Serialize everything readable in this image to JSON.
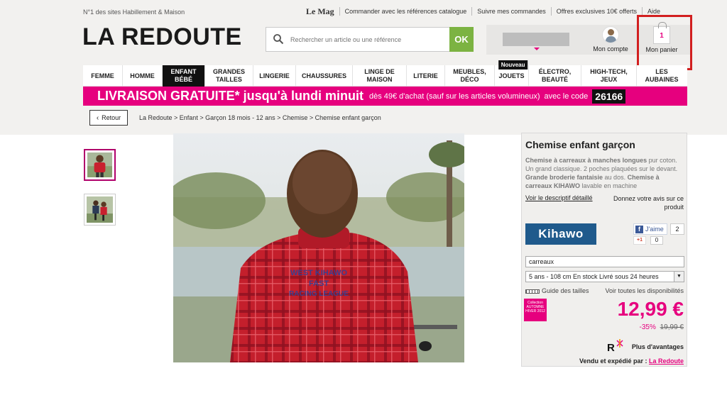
{
  "header": {
    "tagline": "N°1 des sites Habillement & Maison",
    "top_links": [
      "Le Mag",
      "Commander avec les références catalogue",
      "Suivre mes commandes",
      "Offres exclusives 10€ offerts",
      "Aide"
    ],
    "logo": "LA REDOUTE",
    "search": {
      "placeholder": "Rechercher un article ou une référence",
      "button": "OK"
    },
    "account_label": "Mon compte",
    "cart_label": "Mon panier",
    "cart_count": "1"
  },
  "nav": {
    "items": [
      {
        "label_lines": [
          "FEMME"
        ]
      },
      {
        "label_lines": [
          "HOMME"
        ]
      },
      {
        "label_lines": [
          "ENFANT",
          "BÉBÉ"
        ],
        "active": true
      },
      {
        "label_lines": [
          "GRANDES",
          "TAILLES"
        ]
      },
      {
        "label_lines": [
          "LINGERIE"
        ]
      },
      {
        "label_lines": [
          "CHAUSSURES"
        ]
      },
      {
        "label_lines": [
          "LINGE DE",
          "MAISON"
        ]
      },
      {
        "label_lines": [
          "LITERIE"
        ]
      },
      {
        "label_lines": [
          "MEUBLES,",
          "DÉCO"
        ]
      },
      {
        "label_lines": [
          "JOUETS"
        ],
        "badge": "Nouveau"
      },
      {
        "label_lines": [
          "ÉLECTRO,",
          "BEAUTÉ"
        ]
      },
      {
        "label_lines": [
          "HIGH-TECH,",
          "JEUX"
        ]
      },
      {
        "label_lines": [
          "LES",
          "AUBAINES"
        ]
      }
    ]
  },
  "promo": {
    "headline": "LIVRAISON GRATUITE* jusqu'à lundi minuit",
    "condition": "dès 49€ d'achat (sauf sur les articles volumineux)",
    "with_code": "avec le code",
    "code": "26166"
  },
  "back_label": "Retour",
  "breadcrumb": "La Redoute > Enfant > Garçon 18 mois - 12 ans > Chemise > Chemise enfant garçon",
  "product": {
    "title": "Chemise enfant garçon",
    "desc_bold1": "Chemise à carreaux à manches longues",
    "desc1": " pur coton. Un grand classique. 2 poches plaquées sur le devant. ",
    "desc_bold2": "Grande broderie fantaisie",
    "desc2": " au dos. ",
    "desc_bold3": "Chemise à carreaux KIHAWO",
    "desc3": " lavable en machine",
    "link_description": "Voir le descriptif détaillé",
    "link_review": "Donnez votre avis sur ce produit",
    "brand": "Kihawo",
    "like_label": "J'aime",
    "like_count": "2",
    "gplus_label": "+1",
    "gplus_count": "0",
    "color_value": "carreaux",
    "size_value": "5 ans - 108 cm En stock Livré sous 24 heures",
    "size_guide": "Guide des tailles",
    "availability": "Voir toutes les disponibilités",
    "collection_badge": "Collection AUTOMNE HIVER 2012",
    "price": "12,99 €",
    "discount": "-35%",
    "old_price": "19,99 €",
    "plus_label": "Plus d'avantages",
    "sold_by_label": "Vendu et expédié par :",
    "seller": "La Redoute"
  },
  "colors": {
    "pink": "#e6007e",
    "ok_green": "#7cb342",
    "highlight_red": "#d21f1f",
    "brand_blue": "#1f5a8c"
  }
}
